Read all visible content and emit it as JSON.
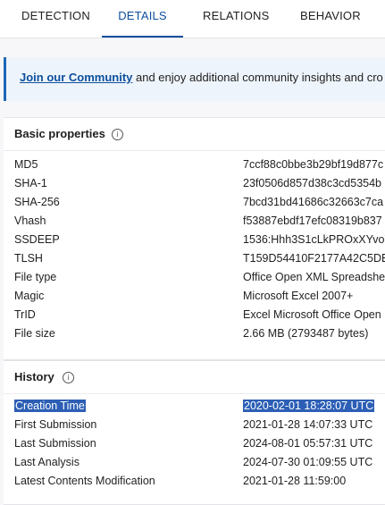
{
  "tabs": [
    {
      "label": "DETECTION"
    },
    {
      "label": "DETAILS"
    },
    {
      "label": "RELATIONS"
    },
    {
      "label": "BEHAVIOR"
    }
  ],
  "banner": {
    "link": "Join our Community",
    "text": " and enjoy additional community insights and cro"
  },
  "basic": {
    "title": "Basic properties",
    "rows": [
      {
        "key": "MD5",
        "value": "7ccf88c0bbe3b29bf19d877c"
      },
      {
        "key": "SHA-1",
        "value": "23f0506d857d38c3cd5354b"
      },
      {
        "key": "SHA-256",
        "value": "7bcd31bd41686c32663c7ca"
      },
      {
        "key": "Vhash",
        "value": "f53887ebdf17efc08319b837"
      },
      {
        "key": "SSDEEP",
        "value": "1536:Hhh3S1cLkPROxXYvoY"
      },
      {
        "key": "TLSH",
        "value": "T159D54410F2177A42C5DB"
      },
      {
        "key": "File type",
        "value": "Office Open XML Spreadshe"
      },
      {
        "key": "Magic",
        "value": "Microsoft Excel 2007+"
      },
      {
        "key": "TrID",
        "value": "Excel Microsoft Office Open"
      },
      {
        "key": "File size",
        "value": "2.66 MB (2793487 bytes)"
      }
    ]
  },
  "history": {
    "title": "History",
    "rows": [
      {
        "key": "Creation Time",
        "value": "2020-02-01 18:28:07 UTC"
      },
      {
        "key": "First Submission",
        "value": "2021-01-28 14:07:33 UTC"
      },
      {
        "key": "Last Submission",
        "value": "2024-08-01 05:57:31 UTC"
      },
      {
        "key": "Last Analysis",
        "value": "2024-07-30 01:09:55 UTC"
      },
      {
        "key": "Latest Contents Modification",
        "value": "2021-01-28 11:59:00"
      }
    ]
  },
  "icons": {
    "info": "info-icon"
  },
  "colors": {
    "accent": "#0b4f9c",
    "selection": "#2c5fb5"
  }
}
